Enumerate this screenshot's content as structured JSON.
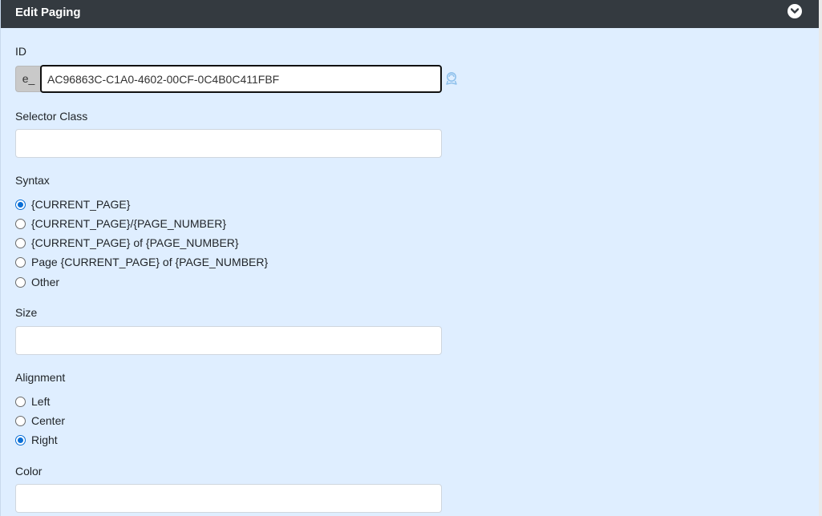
{
  "header": {
    "title": "Edit Paging",
    "collapse_icon": "chevron-down-circle-icon"
  },
  "id_field": {
    "label": "ID",
    "prefix": "e_",
    "value": "AC96863C-C1A0-4602-00CF-0C4B0C411FBF",
    "refresh_icon": "regenerate-icon"
  },
  "selector_class": {
    "label": "Selector Class",
    "value": ""
  },
  "syntax": {
    "label": "Syntax",
    "selected": "{CURRENT_PAGE}",
    "options": [
      "{CURRENT_PAGE}",
      "{CURRENT_PAGE}/{PAGE_NUMBER}",
      "{CURRENT_PAGE} of {PAGE_NUMBER}",
      "Page {CURRENT_PAGE} of {PAGE_NUMBER}",
      "Other"
    ]
  },
  "size": {
    "label": "Size",
    "value": ""
  },
  "alignment": {
    "label": "Alignment",
    "selected": "Right",
    "options": [
      "Left",
      "Center",
      "Right"
    ]
  },
  "color": {
    "label": "Color",
    "value": ""
  },
  "colors": {
    "header_bg": "#343a40",
    "panel_bg": "#dfeeff",
    "accent": "#0b6fd6"
  }
}
